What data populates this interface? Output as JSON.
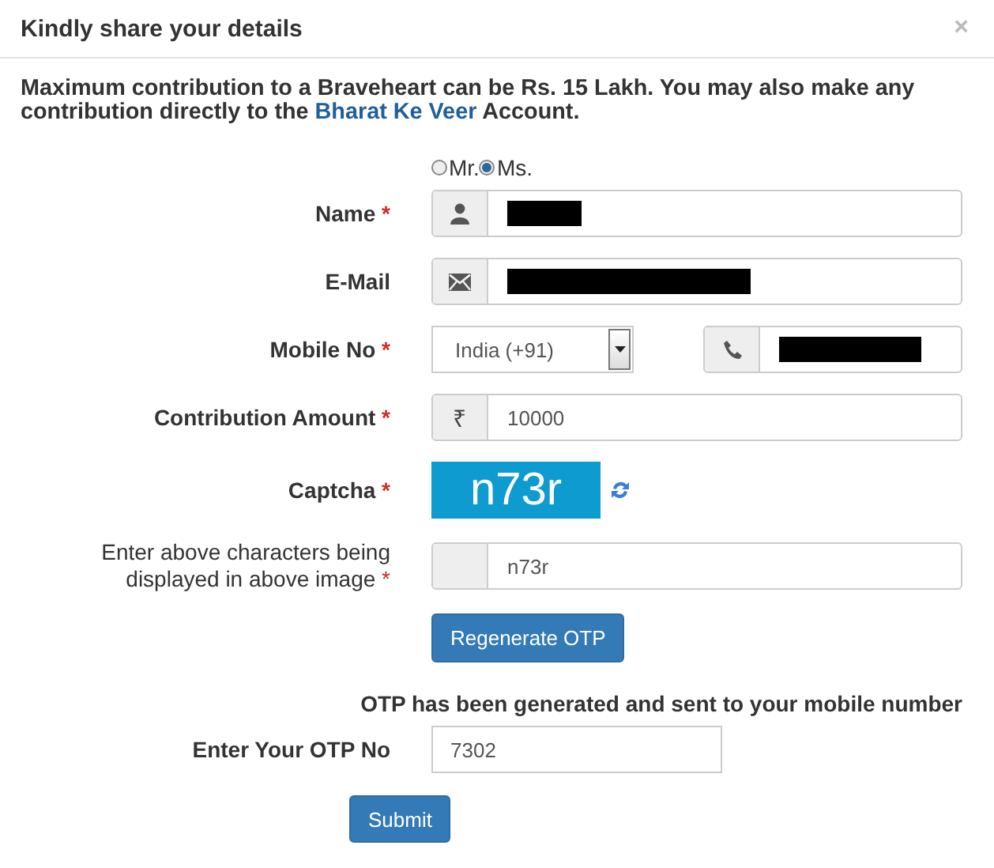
{
  "dialog": {
    "title": "Kindly share your details",
    "close": "×"
  },
  "notice": {
    "before": "Maximum contribution to a Braveheart can be Rs. 15 Lakh. You may also make any contribution directly to the ",
    "link": "Bharat Ke Veer",
    "after": " Account."
  },
  "salutation": [
    {
      "label": "Mr.",
      "selected": false
    },
    {
      "label": "Ms.",
      "selected": true
    }
  ],
  "name_field": {
    "label": "Name",
    "required_mark": "*",
    "redacted": true
  },
  "email_field": {
    "label": "E-Mail",
    "redacted": true
  },
  "mobile_field": {
    "label": "Mobile No",
    "required_mark": "*",
    "country": "India (+91)",
    "redacted": true
  },
  "amount_field": {
    "label": "Contribution Amount",
    "required_mark": "*",
    "prefix": "₹",
    "value": "10000"
  },
  "captcha": {
    "label": "Captcha",
    "required_mark": "*",
    "code": "n73r"
  },
  "captcha_entry": {
    "label": "Enter above characters being displayed in above image",
    "required_mark": "*",
    "value": "n73r"
  },
  "regenerate_button": "Regenerate OTP",
  "otp_message": "OTP has been generated and sent to your mobile number",
  "otp_field": {
    "label": "Enter Your OTP No",
    "value": "7302"
  },
  "submit_button": "Submit"
}
